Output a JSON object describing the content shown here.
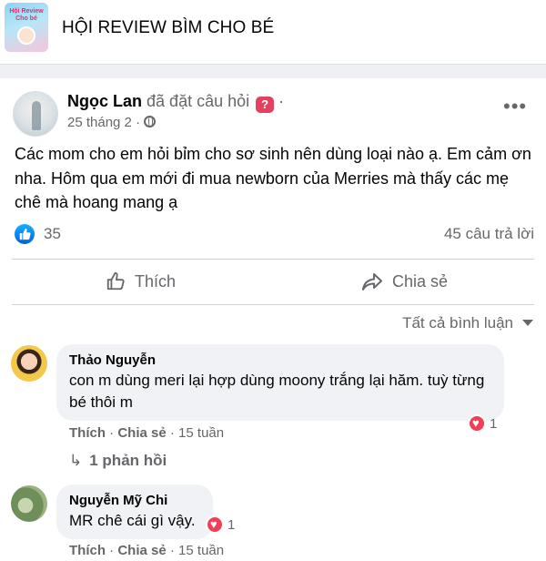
{
  "group": {
    "name": "HỘI REVIEW BÌM CHO BÉ",
    "thumbnail_icon": "group-cover-image",
    "thumbnail_text": "Hội Review Cho bé"
  },
  "post": {
    "author": "Ngọc Lan",
    "action": "đã đặt câu hỏi",
    "question_icon": "question-badge-icon",
    "date": "25 tháng 2",
    "separator": "·",
    "privacy_icon": "globe-icon",
    "more_icon": "more-options-icon",
    "body": "Các mom cho em hỏi bỉm cho sơ sinh nên dùng loại nào ạ. Em cảm ơn nha. Hôm qua em mới đi mua newborn của Merries mà thấy các mẹ chê mà hoang mang ạ",
    "reactions": {
      "icon": "like-reaction-icon",
      "count": "35"
    },
    "answers": "45 câu trả lời"
  },
  "actions": {
    "like_label": "Thích",
    "share_label": "Chia sẻ"
  },
  "sort": {
    "label": "Tất cả bình luận"
  },
  "comments": [
    {
      "name": "Thảo Nguyễn",
      "text": "con m dùng meri lại hợp dùng moony trắng lại hăm. tuỳ từng bé thôi m",
      "like": "Thích",
      "sep1": "·",
      "share": "Chia sẻ",
      "sep2": "·",
      "time": "15 tuần",
      "reaction_count": "1",
      "replies": "1 phản hồi"
    },
    {
      "name": "Nguyễn Mỹ Chi",
      "text": "MR chê cái gì vậy.",
      "like": "Thích",
      "sep1": "·",
      "share": "Chia sẻ",
      "sep2": "·",
      "time": "15 tuần",
      "reaction_count": "1"
    }
  ],
  "colors": {
    "accent": "#1877f2",
    "secondary_text": "#65676b",
    "bubble": "#f0f2f5",
    "heart": "#f33e58",
    "question_badge": "#e4405f"
  }
}
